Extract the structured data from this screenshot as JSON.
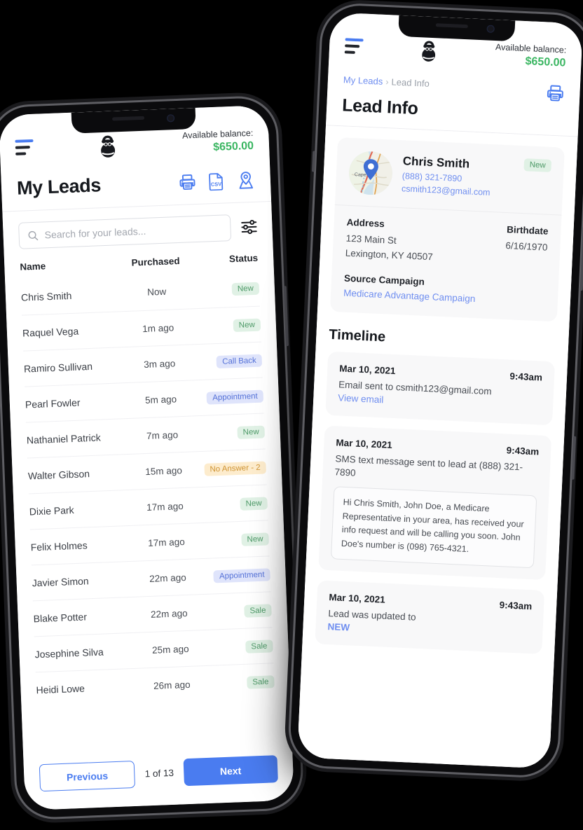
{
  "app": {
    "logo_icon": "kettlebell-logo",
    "menu_icon": "hamburger-menu-icon",
    "balance_label": "Available balance:",
    "balance_amount": "$650.00",
    "accent_blue": "#4a7cf0",
    "accent_green": "#3bb662"
  },
  "leads_screen": {
    "title": "My Leads",
    "actions": [
      {
        "name": "print-icon",
        "label": "Print"
      },
      {
        "name": "csv-icon",
        "label": "CSV"
      },
      {
        "name": "map-pin-icon",
        "label": "Map"
      }
    ],
    "search": {
      "placeholder": "Search for your leads...",
      "value": ""
    },
    "filter_icon": "filter-sliders-icon",
    "columns": [
      "Name",
      "Purchased",
      "Status"
    ],
    "rows": [
      {
        "name": "Chris Smith",
        "purchased": "Now",
        "status": "New",
        "style": "b-new"
      },
      {
        "name": "Raquel Vega",
        "purchased": "1m ago",
        "status": "New",
        "style": "b-new"
      },
      {
        "name": "Ramiro Sullivan",
        "purchased": "3m ago",
        "status": "Call Back",
        "style": "b-call"
      },
      {
        "name": "Pearl Fowler",
        "purchased": "5m ago",
        "status": "Appointment",
        "style": "b-appt"
      },
      {
        "name": "Nathaniel Patrick",
        "purchased": "7m ago",
        "status": "New",
        "style": "b-new"
      },
      {
        "name": "Walter Gibson",
        "purchased": "15m ago",
        "status": "No Answer - 2",
        "style": "b-noans"
      },
      {
        "name": "Dixie Park",
        "purchased": "17m ago",
        "status": "New",
        "style": "b-new"
      },
      {
        "name": "Felix Holmes",
        "purchased": "17m ago",
        "status": "New",
        "style": "b-new"
      },
      {
        "name": "Javier Simon",
        "purchased": "22m ago",
        "status": "Appointment",
        "style": "b-appt"
      },
      {
        "name": "Blake Potter",
        "purchased": "22m ago",
        "status": "Sale",
        "style": "b-sale"
      },
      {
        "name": "Josephine Silva",
        "purchased": "25m ago",
        "status": "Sale",
        "style": "b-sale"
      },
      {
        "name": "Heidi Lowe",
        "purchased": "26m ago",
        "status": "Sale",
        "style": "b-sale"
      }
    ],
    "pagination": {
      "previous": "Previous",
      "count": "1 of 13",
      "next": "Next"
    }
  },
  "lead_info_screen": {
    "breadcrumb": {
      "parent": "My Leads",
      "separator": "›",
      "current": "Lead Info"
    },
    "title": "Lead Info",
    "print_icon": "print-icon",
    "lead": {
      "avatar_icon": "map-thumbnail-avatar",
      "avatar_place_label": "Cape C",
      "name": "Chris Smith",
      "phone": "(888) 321-7890",
      "email": "csmith123@gmail.com",
      "status": "New",
      "address_label": "Address",
      "address_line1": "123 Main St",
      "address_line2": "Lexington, KY 40507",
      "birthdate_label": "Birthdate",
      "birthdate": "6/16/1970",
      "source_label": "Source Campaign",
      "source_campaign": "Medicare Advantage Campaign"
    },
    "timeline_title": "Timeline",
    "timeline": [
      {
        "date": "Mar 10, 2021",
        "time": "9:43am",
        "text": "Email sent to csmith123@gmail.com",
        "link": "View email"
      },
      {
        "date": "Mar 10, 2021",
        "time": "9:43am",
        "text": "SMS text message sent to lead at (888) 321-7890",
        "message": "Hi Chris Smith, John Doe, a Medicare Representative in your area, has received your info request and will be calling you soon. John Doe's number is (098) 765-4321."
      },
      {
        "date": "Mar 10, 2021",
        "time": "9:43am",
        "text": "Lead was updated to",
        "link": "NEW"
      }
    ]
  }
}
